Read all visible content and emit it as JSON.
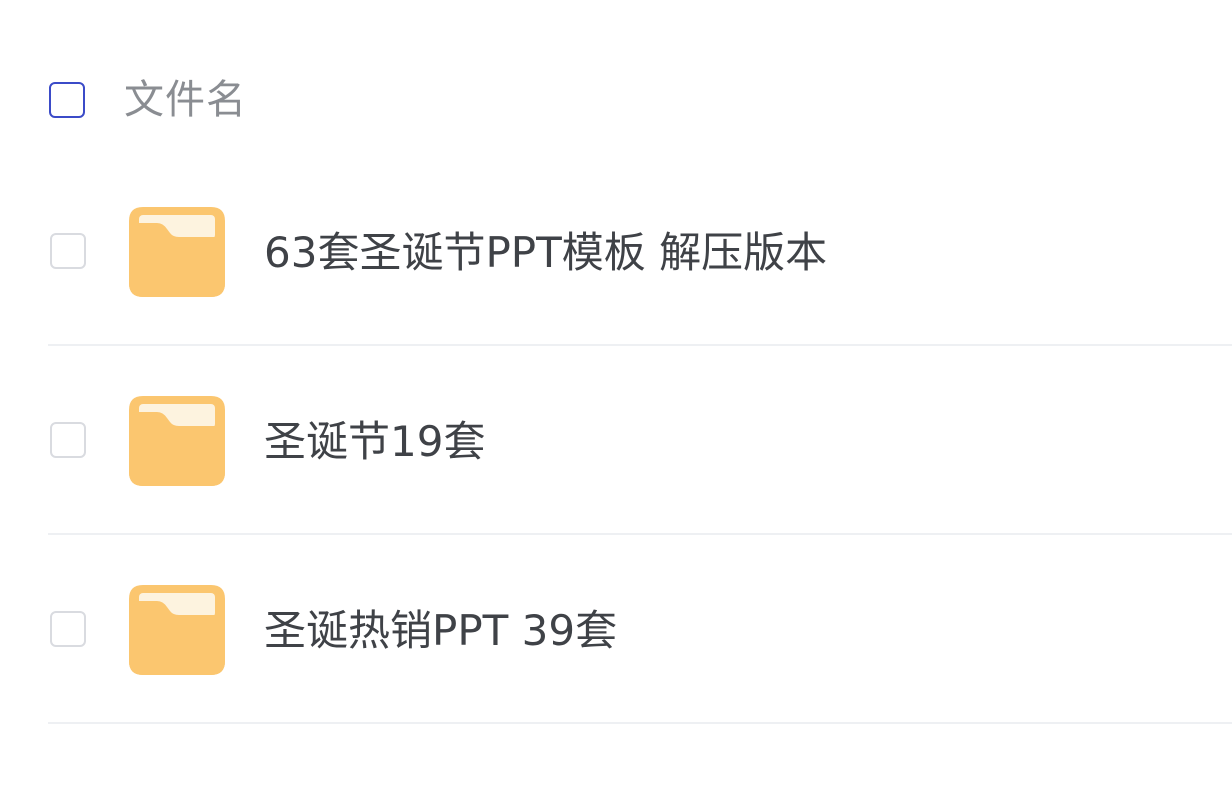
{
  "header": {
    "name_column_label": "文件名"
  },
  "files": [
    {
      "name": "63套圣诞节PPT模板 解压版本",
      "type": "folder"
    },
    {
      "name": "圣诞节19套",
      "type": "folder"
    },
    {
      "name": "圣诞热销PPT 39套",
      "type": "folder"
    }
  ],
  "icons": {
    "folder": "folder-icon"
  },
  "colors": {
    "checkbox_header_border": "#3b4bc8",
    "checkbox_border": "#d9dbe0",
    "folder_body": "#fbc66f",
    "folder_paper": "#fdf3df",
    "text_primary": "#3f4247",
    "text_secondary": "#8a8d92",
    "divider": "#eef0f3"
  }
}
